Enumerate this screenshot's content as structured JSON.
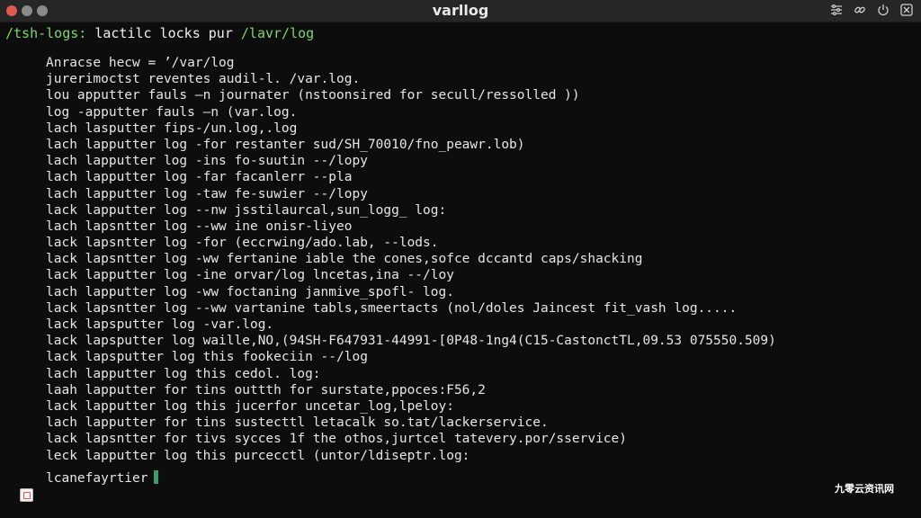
{
  "window": {
    "title": "varllog"
  },
  "prompt": {
    "user": "/tsh-logs:",
    "command": " lactilc locks pur ",
    "path": "/lavr/log"
  },
  "output_lines": [
    "Anracse hecw = ’/var/log",
    "jurerimoctst reventes audil-l. /var.log.",
    "lou apputter fauls –n journater (nstoonsired for secull/ressolled ))",
    "log -apputter fauls –n (var.log.",
    "lach lasputter fips-/un.log,.log",
    "lach lapputter log -for restanter sud/SH_70010/fno_peawr.lob)",
    "lach lapputter log -ins fo-suutin --/lopy",
    "lach lapputter log -far facanlerr --pla",
    "lach lapputter log -taw fe-suwier --/lopy",
    "lack lapputter log --nw jsstilaurcal,sun_logg_ log:",
    "lach lapsntter log --ww ine onisr-liyeo",
    "lack lapsntter log -for (eccrwing/ado.lab, --lods.",
    "lack lapsntter log -ww fertanine iable the cones,sofce dccantd caps/shacking",
    "lack lapputter log -ine orvar/log lncetas,ina --/loy",
    "lach lapputter log -ww foctaning janmive_spofl- log.",
    "lack lapsntter log --ww vartanine tabls,smeertacts (nol/doles Jaincest fit_vash log.....",
    "lack lapsputter log -var.log.",
    "lack lapsputter log waille,NO,(94SH-F647931-44991-[0P48-1ng4(C15-CastonctTL,09.53 075550.509)",
    "lack lapsputter log this fookeciin --/log",
    "lach lapputter log this cedol. log:",
    "laah lapputter for tins outtth for surstate,ppoces:F56,2",
    "lack lapputter log this jucerfor uncetar_log,lpeloy:",
    "lach lapputter for tins sustecttl letacalk so.tat/lackerservice.",
    "lack lapsntter for tivs sycces 1f the othos,jurtcel tatevery.por/sservice)",
    "leck lapputter log this purcecctl (untor/ldiseptr.log:"
  ],
  "cursor_line": {
    "text": "lcanefayrtier"
  },
  "watermark": "九零云资讯网",
  "colors": {
    "background": "#0d0d0d",
    "titlebar": "#262626",
    "prompt_green": "#7fd66a",
    "cursor": "#3f9a6c",
    "close_button": "#e0584f"
  }
}
